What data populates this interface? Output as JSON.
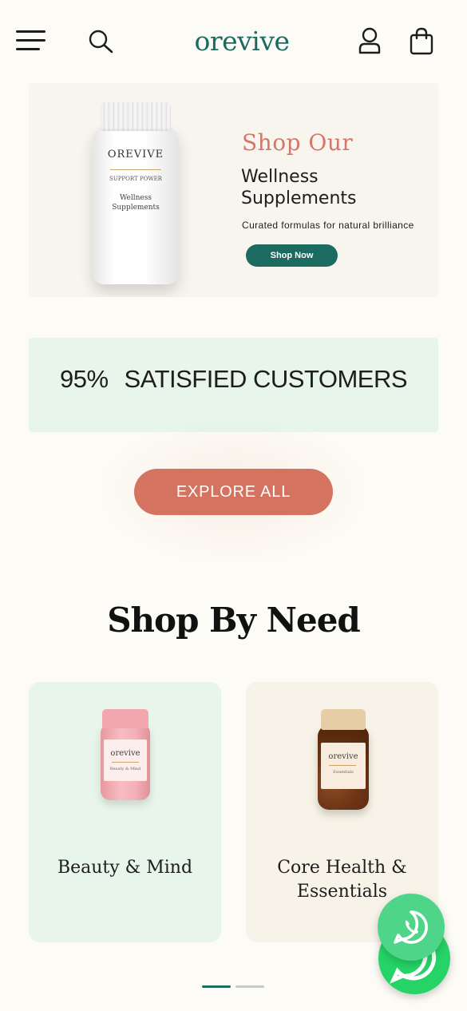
{
  "header": {
    "logo": "orevive",
    "icons": [
      "menu-icon",
      "search-icon",
      "user-icon",
      "shopping-bag-icon"
    ]
  },
  "hero": {
    "kicker": "Shop Our",
    "title": "Wellness Supplements",
    "subtitle": "Curated formulas for natural brilliance",
    "cta_label": "Shop Now",
    "product": {
      "brand": "OREVIVE",
      "line": "SUPPORT POWER",
      "desc_line1": "Wellness",
      "desc_line2": "Supplements"
    }
  },
  "stats": {
    "percent": "95%",
    "label": "SATISFIED CUSTOMERS"
  },
  "explore": {
    "label": "EXPLORE ALL"
  },
  "shop_by_need": {
    "title": "Shop By Need",
    "cards": [
      {
        "label": "Beauty & Mind",
        "jar_brand": "orevive",
        "jar_sub": "Beauty & Mind"
      },
      {
        "label_line1": "Core Health &",
        "label_line2": "Essentials",
        "jar_brand": "orevive",
        "jar_sub": "Essentials"
      }
    ]
  },
  "carousel": {
    "active_index": 0,
    "count": 2
  },
  "colors": {
    "brand_green": "#1c6b60",
    "accent_coral": "#d4735f",
    "kicker_coral": "#d4776a",
    "mint": "#e7f5ea",
    "whatsapp": "#25d366"
  },
  "chat_widget": {
    "icon": "whatsapp-icon"
  }
}
